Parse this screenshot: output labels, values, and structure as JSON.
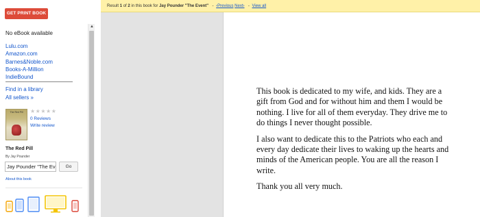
{
  "sidebar": {
    "get_print_book": "GET PRINT BOOK",
    "no_ebook": "No eBook available",
    "sellers": [
      "Lulu.com",
      "Amazon.com",
      "Barnes&Noble.com",
      "Books-A-Million",
      "IndieBound"
    ],
    "find_in_library": "Find in a library",
    "all_sellers": "All sellers »",
    "cover_title": "The Red Pill",
    "stars": "★★★★★",
    "rating_filled": 0,
    "reviews_count": "0 Reviews",
    "write_review": "Write review",
    "book_title": "The Red Pill",
    "book_author": "By Jay Pounder",
    "search_value": "Jay Pounder \"The Eve",
    "go_label": "Go",
    "about_this_book": "About this book",
    "device_icons": [
      "phone-icon",
      "tablet-icon",
      "ereader-icon",
      "desktop-icon",
      "mobile-icon"
    ]
  },
  "resultbar": {
    "prefix": "Result ",
    "current": "1",
    "of_text": " of ",
    "total": "2",
    "in_this_book": " in this book for ",
    "query": "Jay Pounder \"The Event\"",
    "prev": "‹Previous",
    "next": "Next›",
    "view_all": "View all"
  },
  "page": {
    "paragraphs": [
      "This book is dedicated to my wife, and kids. They are a gift from God and for without him and them I would be nothing.  I live for all of them everyday.  They drive me to do things I never thought possible.",
      "I also want to dedicate this to the Patriots who each and every day dedicate their lives to waking up the hearts and minds of the American people.  You are all the reason I write.",
      "Thank you all very much."
    ]
  },
  "colors": {
    "print_button": "#dd4b39",
    "link": "#1155cc",
    "result_bar": "#fff1a8",
    "viewer_bg": "#e3e3e3"
  }
}
